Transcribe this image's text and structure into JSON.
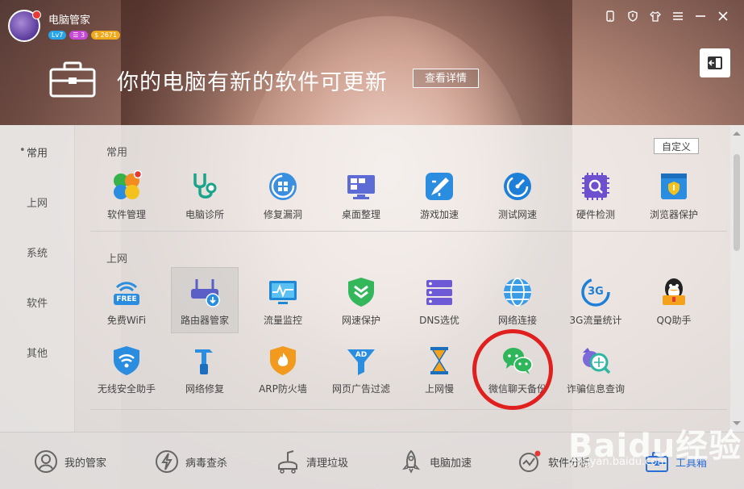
{
  "app": {
    "title": "电脑管家"
  },
  "user": {
    "level": "Lv7",
    "vip": "3",
    "coins": "2671"
  },
  "banner": {
    "message": "你的电脑有新的软件可更新",
    "detail_button": "查看详情"
  },
  "nav": {
    "items": [
      "常用",
      "上网",
      "系统",
      "软件",
      "其他"
    ],
    "active": "常用"
  },
  "custom_button": "自定义",
  "sections": [
    {
      "title": "常用",
      "tools": [
        {
          "label": "软件管理",
          "icon": "software-manage-icon"
        },
        {
          "label": "电脑诊所",
          "icon": "stethoscope-icon"
        },
        {
          "label": "修复漏洞",
          "icon": "repair-vulnerability-icon"
        },
        {
          "label": "桌面整理",
          "icon": "desktop-organize-icon"
        },
        {
          "label": "游戏加速",
          "icon": "game-boost-icon"
        },
        {
          "label": "测试网速",
          "icon": "speed-test-icon"
        },
        {
          "label": "硬件检测",
          "icon": "hardware-check-icon"
        },
        {
          "label": "浏览器保护",
          "icon": "browser-protect-icon"
        }
      ]
    },
    {
      "title": "上网",
      "tools": [
        {
          "label": "免费WiFi",
          "icon": "free-wifi-icon",
          "badge": "FREE"
        },
        {
          "label": "路由器管家",
          "icon": "router-icon"
        },
        {
          "label": "流量监控",
          "icon": "traffic-monitor-icon"
        },
        {
          "label": "网速保护",
          "icon": "speed-protect-icon"
        },
        {
          "label": "DNS选优",
          "icon": "dns-icon"
        },
        {
          "label": "网络连接",
          "icon": "network-globe-icon"
        },
        {
          "label": "3G流量统计",
          "icon": "3g-stats-icon",
          "badge": "3G"
        },
        {
          "label": "QQ助手",
          "icon": "qq-assistant-icon"
        },
        {
          "label": "无线安全助手",
          "icon": "wifi-security-icon"
        },
        {
          "label": "网络修复",
          "icon": "network-repair-icon"
        },
        {
          "label": "ARP防火墙",
          "icon": "arp-firewall-icon"
        },
        {
          "label": "网页广告过滤",
          "icon": "ad-filter-icon",
          "badge": "AD"
        },
        {
          "label": "上网慢",
          "icon": "hourglass-icon"
        },
        {
          "label": "微信聊天备份",
          "icon": "wechat-backup-icon"
        },
        {
          "label": "诈骗信息查询",
          "icon": "fraud-search-icon"
        }
      ]
    }
  ],
  "bottom_tabs": [
    {
      "label": "我的管家",
      "icon": "my-manager-icon"
    },
    {
      "label": "病毒查杀",
      "icon": "virus-scan-icon"
    },
    {
      "label": "清理垃圾",
      "icon": "cleanup-icon"
    },
    {
      "label": "电脑加速",
      "icon": "rocket-icon"
    },
    {
      "label": "软件分析",
      "icon": "software-analysis-icon"
    },
    {
      "label": "工具箱",
      "icon": "toolbox-icon"
    }
  ],
  "active_bottom_tab": "工具箱",
  "watermark": {
    "main": "Baidu经验",
    "sub": "jingyan.baidu.com"
  },
  "colors": {
    "accent": "#2b6fd6",
    "highlight": "#e0201f"
  }
}
